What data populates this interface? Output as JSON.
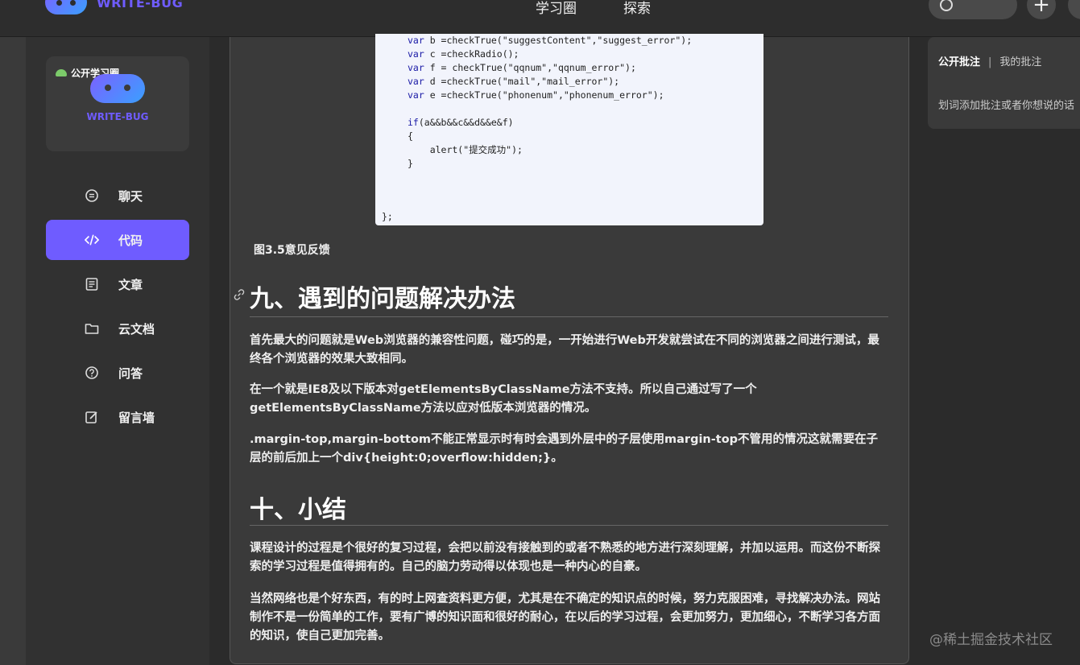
{
  "header": {
    "logo_text": "WRITE-BUG",
    "nav": [
      "学习圈",
      "探索"
    ]
  },
  "sidebar": {
    "card": {
      "tag": "公开学习圈",
      "name": "WRITE-BUG"
    },
    "items": [
      {
        "label": "聊天",
        "icon": "chat-icon"
      },
      {
        "label": "代码",
        "icon": "code-icon",
        "active": true
      },
      {
        "label": "文章",
        "icon": "article-icon"
      },
      {
        "label": "云文档",
        "icon": "folder-icon"
      },
      {
        "label": "问答",
        "icon": "question-icon"
      },
      {
        "label": "留言墙",
        "icon": "edit-icon"
      }
    ]
  },
  "article": {
    "code_lines": [
      {
        "kw": "var",
        "rest": " b =checkTrue(\"suggestContent\",\"suggest_error\");"
      },
      {
        "kw": "var",
        "rest": " c =checkRadio();"
      },
      {
        "kw": "var",
        "rest": " f = checkTrue(\"qqnum\",\"qqnum_error\");"
      },
      {
        "kw": "var",
        "rest": " d =checkTrue(\"mail\",\"mail_error\");"
      },
      {
        "kw": "var",
        "rest": " e =checkTrue(\"phonenum\",\"phonenum_error\");"
      },
      {
        "kw": "",
        "rest": ""
      },
      {
        "kw": "if",
        "rest": "(a&&b&&c&&d&&e&f)"
      },
      {
        "kw": "",
        "rest": "{"
      },
      {
        "kw": "",
        "rest": "    alert(\"提交成功\");"
      },
      {
        "kw": "",
        "rest": "}"
      }
    ],
    "code_close": "};",
    "figure_caption": "图3.5意见反馈",
    "heading1": "九、遇到的问题解决办法",
    "p1": "首先最大的问题就是Web浏览器的兼容性问题，碰巧的是，一开始进行Web开发就尝试在不同的浏览器之间进行测试，最终各个浏览器的效果大致相同。",
    "p2": "在一个就是IE8及以下版本对getElementsByClassName方法不支持。所以自己通过写了一个getElementsByClassName方法以应对低版本浏览器的情况。",
    "p3": ".margin-top,margin-bottom不能正常显示时有时会遇到外层中的子层使用margin-top不管用的情况这就需要在子层的前后加上一个div{height:0;overflow:hidden;}。",
    "heading2": "十、小结",
    "p4": "课程设计的过程是个很好的复习过程，会把以前没有接触到的或者不熟悉的地方进行深刻理解，并加以运用。而这份不断探索的学习过程是值得拥有的。自己的脑力劳动得以体现也是一种内心的自豪。",
    "p5": "当然网络也是个好东西，有的时上网查资料更方便，尤其是在不确定的知识点的时候，努力克服困难，寻找解决办法。网站制作不是一份简单的工作，要有广博的知识面和很好的耐心，在以后的学习过程，会更加努力，更加细心，不断学习各方面的知识，使自己更加完善。"
  },
  "annotations": {
    "tab_public": "公开批注",
    "separator": "|",
    "tab_mine": "我的批注",
    "hint": "划词添加批注或者你想说的话"
  },
  "watermark": "@稀土掘金技术社区",
  "colors": {
    "accent": "#6f5cff",
    "background": "#2b2b2b",
    "panel": "#3a3a3a"
  }
}
